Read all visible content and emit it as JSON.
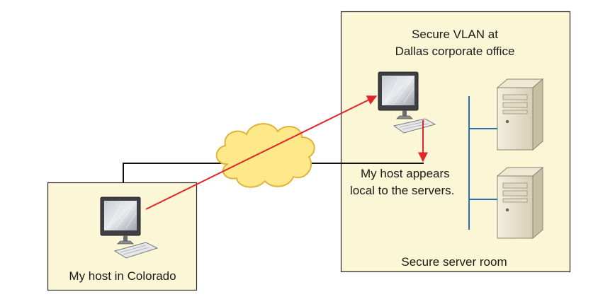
{
  "labels": {
    "vlan_title_line1": "Secure VLAN at",
    "vlan_title_line2": "Dallas corporate office",
    "appears_line1": "My host appears",
    "appears_line2": "local to the servers.",
    "server_room": "Secure server room",
    "colorado_host": "My host in Colorado"
  },
  "nodes": [
    {
      "id": "colorado-host",
      "type": "workstation",
      "icon": "desktop-computer-icon"
    },
    {
      "id": "dallas-host",
      "type": "workstation",
      "icon": "desktop-computer-icon"
    },
    {
      "id": "internet",
      "type": "cloud",
      "icon": "cloud-icon"
    },
    {
      "id": "server-1",
      "type": "server",
      "icon": "server-tower-icon"
    },
    {
      "id": "server-2",
      "type": "server",
      "icon": "server-tower-icon"
    }
  ],
  "colors": {
    "zone_fill": "#fbf6d6",
    "zone_border": "#2a2a2a",
    "cloud_fill": "#fde98a",
    "cloud_stroke": "#e2b23a",
    "vpn_arrow": "#e0262b",
    "server_link": "#2f6db0",
    "wire": "#111111"
  }
}
